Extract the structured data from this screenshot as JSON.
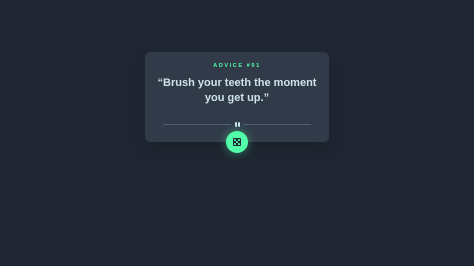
{
  "advice": {
    "id_label": "ADVICE #91",
    "quote": "“Brush your teeth the moment you get up.”"
  },
  "divider": {
    "icon": "pause-icon"
  },
  "dice_button": {
    "icon": "dice-icon"
  },
  "colors": {
    "background": "#202733",
    "card": "#313a49",
    "accent": "#52ffa8",
    "text": "#cee3e9",
    "divider": "#4f5d74"
  }
}
